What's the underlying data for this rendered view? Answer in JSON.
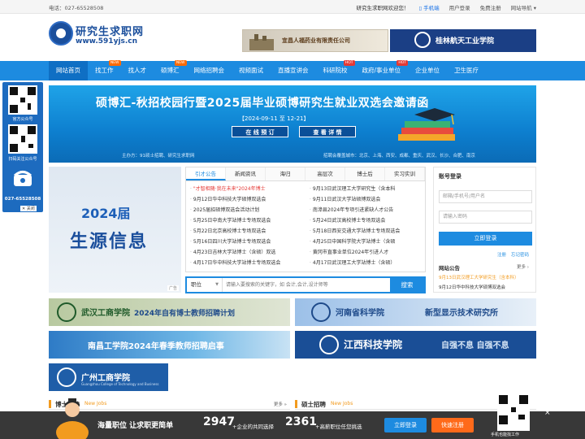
{
  "topbar": {
    "phone": "电话：027-65528508",
    "welcome": "研究生求职网欢迎您！",
    "mobile": "手机端",
    "login": "用户登录",
    "register": "免费注册",
    "site_nav": "网站导航"
  },
  "logo": {
    "name": "研究生求职网",
    "url": "www.591yjs.cn"
  },
  "header_ads": [
    {
      "text": "宜昌人福药业有限责任公司"
    },
    {
      "text": "桂林航天工业学院"
    }
  ],
  "nav": [
    {
      "label": "网站首页",
      "tag": ""
    },
    {
      "label": "找工作",
      "tag": "NEW"
    },
    {
      "label": "找人才",
      "tag": ""
    },
    {
      "label": "硕博汇",
      "tag": "NEW"
    },
    {
      "label": "网络招聘会",
      "tag": ""
    },
    {
      "label": "视频面试",
      "tag": ""
    },
    {
      "label": "直播宣讲会",
      "tag": ""
    },
    {
      "label": "科研院校",
      "tag": "HOT"
    },
    {
      "label": "政府/事业单位",
      "tag": "HOT"
    },
    {
      "label": "企业单位",
      "tag": ""
    },
    {
      "label": "卫生医疗",
      "tag": ""
    }
  ],
  "sidebar": {
    "qr1_label": "官方公众号",
    "qr2_label": "扫码关注公众号",
    "tel": "027-65528508",
    "close": "关闭"
  },
  "banner": {
    "title": "硕博汇-秋招校园行暨2025届毕业硕博研究生就业双选会邀请函",
    "date": "【2024-09-11  至 12-21】",
    "btn_book": "在 线 预 订",
    "btn_detail": "查 看 详 情",
    "organizer": "主办方：91硕士招聘、研究生求职网",
    "cities": "招聘会覆盖城市：北京、上海、西安、成都、重庆、武汉、长沙、合肥、南京"
  },
  "promo": {
    "year": "2024届",
    "title": "生源信息",
    "ad_tag": "广告"
  },
  "news": {
    "tabs": [
      "引才公告",
      "新闻资讯",
      "海归",
      "高层次",
      "博士后",
      "实习实训"
    ],
    "active_tab": 0,
    "left": [
      {
        "text": "\"才智相随·我在未来\"2024年博士",
        "hl": true
      },
      {
        "text": "9月12日华中科技大学硕博双选会",
        "hl": false
      },
      {
        "text": "2025届招硕博双选会活动计划",
        "hl": false
      },
      {
        "text": "5月25日中南大学站博士专场双选会",
        "hl": false
      },
      {
        "text": "5月22日北京高校博士专场双选会",
        "hl": false
      },
      {
        "text": "5月16日四川大学站博士专场双选会",
        "hl": false
      },
      {
        "text": "4月23日吉林大学站博士（含硕）双选",
        "hl": false
      },
      {
        "text": "4月17日华中科技大学站博士专场双选会",
        "hl": false
      }
    ],
    "right": [
      {
        "text": "9月13日武汉理工大学研究生（含本科",
        "hl": false
      },
      {
        "text": "9月11日武汉大学站硕博双选会",
        "hl": false
      },
      {
        "text": "南漳县2024年专项引进紧缺人才公告",
        "hl": false
      },
      {
        "text": "5月24日武汉高校博士专场双选会",
        "hl": false
      },
      {
        "text": "5月18日西安交通大学站博士专场双选会",
        "hl": false
      },
      {
        "text": "4月25日中国科学院大学站博士（含硕",
        "hl": false
      },
      {
        "text": "黄冈市直事业单位2024年引进人才",
        "hl": false
      },
      {
        "text": "4月17日武汉理工大学站博士（含硕）",
        "hl": false
      }
    ]
  },
  "search": {
    "type": "职位",
    "placeholder": "请输入要搜索的关键字，如 会计,会计,设计师等",
    "button": "搜索"
  },
  "login": {
    "title": "账号登录",
    "user_placeholder": "邮箱/手机号/用户名",
    "pass_placeholder": "请输入密码",
    "button": "立即登录",
    "register": "注册",
    "forgot": "忘记密码",
    "announce_title": "网站公告",
    "more": "更多",
    "announcements": [
      {
        "text": "9月13日武汉理工大学研究生（含本科）",
        "hl": true
      },
      {
        "text": "9月12日华中科技大学硕博双选会",
        "hl": false
      }
    ]
  },
  "ads": {
    "a1_name": "武汉工商学院",
    "a1_text": "2024年自有博士教师招聘计划",
    "a2_name": "河南省科学院",
    "a2_text": "新型显示技术研究所",
    "a3_text": "南昌工学院2024年春季教师招聘启事",
    "a4_name": "江西科技学院",
    "a4_text": "自强不息 自强不息",
    "a5_name": "广州工商学院",
    "a5_sub": "Guangzhou College of Technology and Business"
  },
  "sections": {
    "left_title": "博士招聘",
    "left_en": "New Jobs",
    "right_title": "硕士招聘",
    "right_en": "New Jobs",
    "more": "更多"
  },
  "bottom_bar": {
    "slogan": "海量职位 让求职更简单",
    "count1": "2947",
    "label1": "+企业的共同选择",
    "count2": "2361",
    "label2": "+高薪职位任您挑选",
    "login": "立即登录",
    "register": "快速注册",
    "qr_caption": "手机也能找工作",
    "close": "×"
  }
}
